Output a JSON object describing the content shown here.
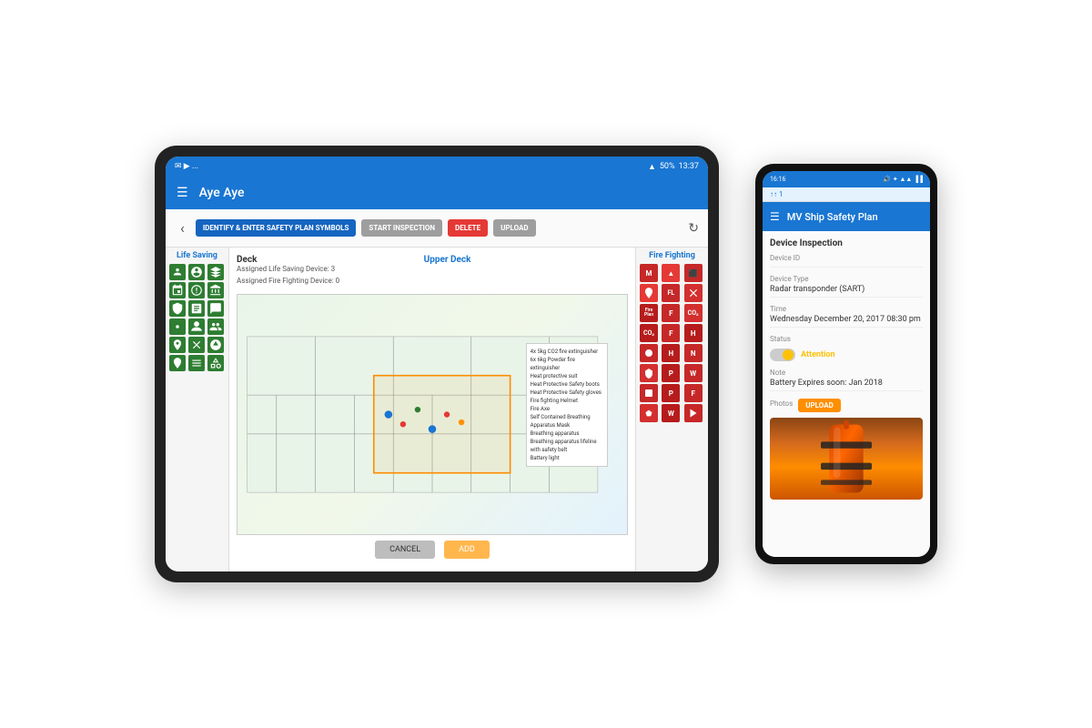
{
  "tablet": {
    "status_bar": {
      "left_icons": "✉ ▶ ...",
      "time": "13:37",
      "battery": "50%",
      "wifi": "▲"
    },
    "header": {
      "title": "Aye Aye"
    },
    "toolbar": {
      "identify_btn": "IDENTIFY & ENTER SAFETY PLAN SYMBOLS",
      "start_inspection_btn": "START INSPECTION",
      "delete_btn": "DELETE",
      "upload_btn": "UPLOAD"
    },
    "life_saving": {
      "title": "Life Saving"
    },
    "deck": {
      "title": "Deck",
      "upper_deck_title": "Upper Deck",
      "life_saving_device_label": "Assigned Life Saving Device:",
      "life_saving_device_value": "3",
      "fire_fighting_device_label": "Assigned Fire Fighting Device:",
      "fire_fighting_device_value": "0"
    },
    "fire_fighting": {
      "title": "Fire Fighting"
    },
    "tooltip": {
      "lines": [
        "4x 5kg CO2 fire extinguisher",
        "6x 6kg Powder fire extinguisher",
        "Heat protective suit",
        "Heat Protective Safety boots",
        "Heat Protective Safety gloves",
        "Fire fighting Helmet",
        "Fire Axe",
        "Self Contained Breathing Apparatus Mask",
        "Breathing apparatus",
        "Self Contained Breathing",
        "Breathing apparatus lifeline with safety belt",
        "Battery light"
      ]
    },
    "actions": {
      "cancel_btn": "CANCEL",
      "add_btn": "ADD"
    }
  },
  "phone": {
    "status_bar": {
      "time": "16:16",
      "icons": "🔊 ✦ ⊙ ✔ ▲▲ ▐▐"
    },
    "notification": "↑ 1",
    "header": {
      "title": "MV Ship Safety Plan"
    },
    "content": {
      "section_title": "Device Inspection",
      "device_id_label": "Device ID",
      "device_id_value": "",
      "device_type_label": "Device Type",
      "device_type_value": "Radar transponder (SART)",
      "time_label": "Time",
      "time_value": "Wednesday December 20, 2017 08:30 pm",
      "status_label": "Status",
      "status_value": "Attention",
      "note_label": "Note",
      "note_value": "Battery Expires soon: Jan 2018",
      "photos_label": "Photos",
      "upload_btn": "UPLOAD"
    }
  }
}
